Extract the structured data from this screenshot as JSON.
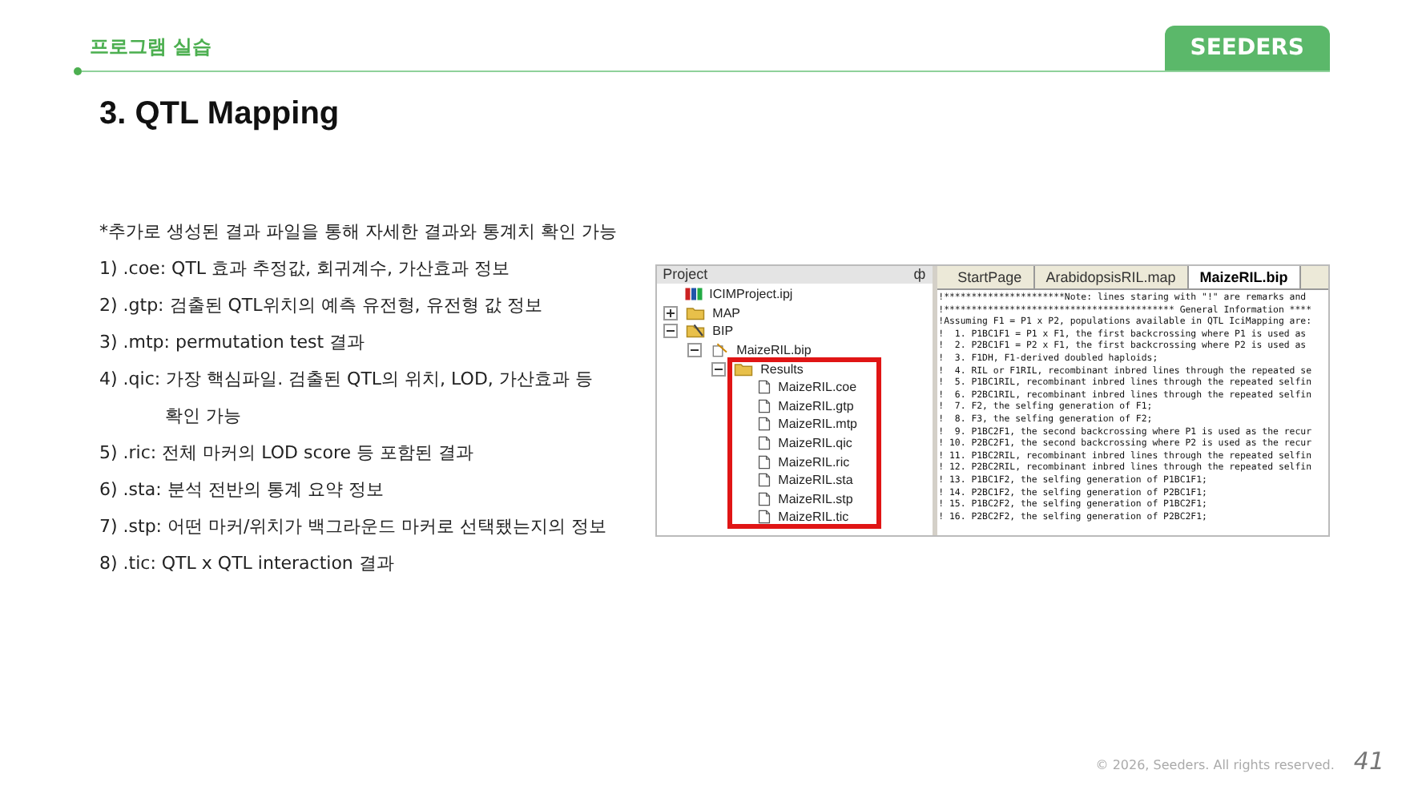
{
  "header": {
    "section": "프로그램 실습",
    "brand": "SEEDERS"
  },
  "title": "3. QTL Mapping",
  "intro": "*추가로 생성된 결과 파일을 통해 자세한 결과와 통계치 확인 가능",
  "items": [
    {
      "text": "1) .coe: QTL 효과 추정값, 회귀계수, 가산효과 정보"
    },
    {
      "text": "2) .gtp: 검출된 QTL위치의 예측 유전형, 유전형 값 정보"
    },
    {
      "text": "3) .mtp: permutation test 결과"
    },
    {
      "text": "4) .qic: 가장 핵심파일. 검출된 QTL의 위치, LOD, 가산효과 등",
      "continuation": "확인 가능"
    },
    {
      "text": "5) .ric: 전체 마커의 LOD score 등 포함된 결과"
    },
    {
      "text": "6) .sta: 분석 전반의 통계 요약 정보"
    },
    {
      "text": "7) .stp: 어떤 마커/위치가 백그라운드 마커로 선택됐는지의 정보"
    },
    {
      "text": "8) .tic: QTL x QTL interaction 결과"
    }
  ],
  "app_window": {
    "project_panel": {
      "title": "Project",
      "pin": "ф",
      "tree": [
        {
          "label": "ICIMProject.ipj",
          "kind": "project"
        },
        {
          "label": "MAP",
          "kind": "folder",
          "expanded": false
        },
        {
          "label": "BIP",
          "kind": "bip-folder",
          "expanded": true,
          "children": [
            {
              "label": "MaizeRIL.bip",
              "kind": "bip",
              "expanded": true,
              "children": [
                {
                  "label": "Results",
                  "kind": "folder",
                  "expanded": true,
                  "highlighted": true,
                  "children": [
                    {
                      "label": "MaizeRIL.coe",
                      "kind": "file"
                    },
                    {
                      "label": "MaizeRIL.gtp",
                      "kind": "file"
                    },
                    {
                      "label": "MaizeRIL.mtp",
                      "kind": "file"
                    },
                    {
                      "label": "MaizeRIL.qic",
                      "kind": "file"
                    },
                    {
                      "label": "MaizeRIL.ric",
                      "kind": "file"
                    },
                    {
                      "label": "MaizeRIL.sta",
                      "kind": "file"
                    },
                    {
                      "label": "MaizeRIL.stp",
                      "kind": "file"
                    },
                    {
                      "label": "MaizeRIL.tic",
                      "kind": "file"
                    }
                  ]
                }
              ]
            }
          ]
        }
      ]
    },
    "tabs": [
      {
        "label": "StartPage",
        "selected": false
      },
      {
        "label": "ArabidopsisRIL.map",
        "selected": false
      },
      {
        "label": "MaizeRIL.bip",
        "selected": true
      }
    ],
    "code_lines": [
      "!**********************Note: lines staring with \"!\" are remarks and",
      "!****************************************** General Information ****",
      "!Assuming F1 = P1 x P2, populations available in QTL IciMapping are:",
      "!  1. P1BC1F1 = P1 x F1, the first backcrossing where P1 is used as",
      "!  2. P2BC1F1 = P2 x F1, the first backcrossing where P2 is used as",
      "!  3. F1DH, F1-derived doubled haploids;",
      "!  4. RIL or F1RIL, recombinant inbred lines through the repeated se",
      "!  5. P1BC1RIL, recombinant inbred lines through the repeated selfin",
      "!  6. P2BC1RIL, recombinant inbred lines through the repeated selfin",
      "!  7. F2, the selfing generation of F1;",
      "!  8. F3, the selfing generation of F2;",
      "!  9. P1BC2F1, the second backcrossing where P1 is used as the recur",
      "! 10. P2BC2F1, the second backcrossing where P2 is used as the recur",
      "! 11. P1BC2RIL, recombinant inbred lines through the repeated selfin",
      "! 12. P2BC2RIL, recombinant inbred lines through the repeated selfin",
      "! 13. P1BC1F2, the selfing generation of P1BC1F1;",
      "! 14. P2BC1F2, the selfing generation of P2BC1F1;",
      "! 15. P1BC2F2, the selfing generation of P1BC2F1;",
      "! 16. P2BC2F2, the selfing generation of P2BC2F1;"
    ]
  },
  "footer": {
    "copyright": "© 2026, Seeders. All rights reserved.",
    "page": "41"
  }
}
